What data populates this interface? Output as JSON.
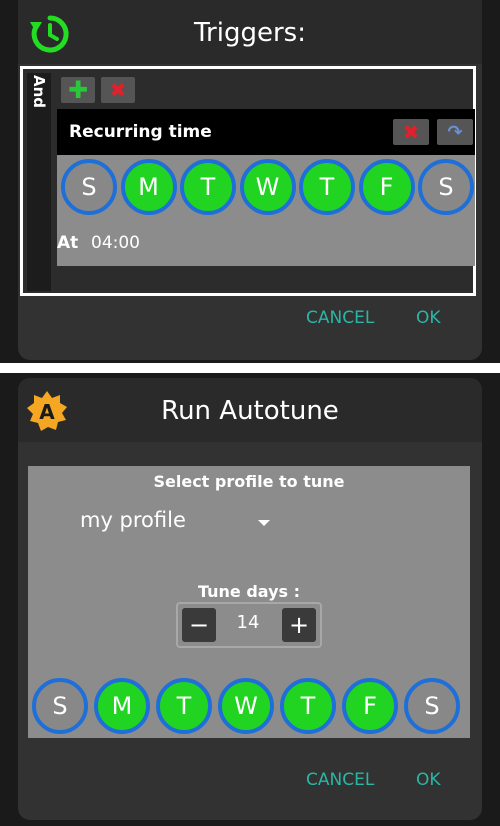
{
  "triggers_dialog": {
    "title": "Triggers:",
    "icon": "refresh-clock-icon",
    "group_label": "And",
    "add_icon": "plus-icon",
    "remove_icon": "delete-x-icon",
    "trigger": {
      "title": "Recurring time",
      "delete_icon": "delete-x-icon",
      "undo_icon": "undo-icon",
      "days": [
        {
          "label": "S",
          "selected": false
        },
        {
          "label": "M",
          "selected": true
        },
        {
          "label": "T",
          "selected": true
        },
        {
          "label": "W",
          "selected": true
        },
        {
          "label": "T",
          "selected": true
        },
        {
          "label": "F",
          "selected": true
        },
        {
          "label": "S",
          "selected": false
        }
      ],
      "at_label": "At",
      "time": "04:00"
    },
    "cancel_label": "CANCEL",
    "ok_label": "OK"
  },
  "autotune_dialog": {
    "title": "Run Autotune",
    "icon": "autotune-badge-icon",
    "icon_letter": "A",
    "select_label": "Select profile to tune",
    "profile_value": "my profile",
    "tune_days_label": "Tune days :",
    "tune_days_value": "14",
    "minus_label": "−",
    "plus_label": "+",
    "days": [
      {
        "label": "S",
        "selected": false
      },
      {
        "label": "M",
        "selected": true
      },
      {
        "label": "T",
        "selected": true
      },
      {
        "label": "W",
        "selected": true
      },
      {
        "label": "T",
        "selected": true
      },
      {
        "label": "F",
        "selected": true
      },
      {
        "label": "S",
        "selected": false
      }
    ],
    "cancel_label": "CANCEL",
    "ok_label": "OK"
  },
  "colors": {
    "accent": "#2bb5a5",
    "day_on": "#21d421",
    "day_ring": "#1e6fd8",
    "add_green": "#28c83a",
    "delete_red": "#e0202a",
    "icon_green": "#22dd22",
    "icon_orange": "#f5a623"
  }
}
